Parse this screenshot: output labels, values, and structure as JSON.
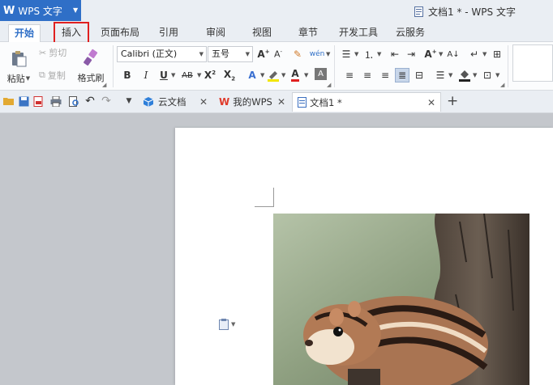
{
  "app": {
    "name": "WPS 文字",
    "logo": "W"
  },
  "window": {
    "title": "文档1 * - WPS 文字"
  },
  "ribbon_tabs": [
    {
      "label": "开始",
      "active": true
    },
    {
      "label": "插入",
      "highlighted": true
    },
    {
      "label": "页面布局"
    },
    {
      "label": "引用"
    },
    {
      "label": "审阅"
    },
    {
      "label": "视图"
    },
    {
      "label": "章节"
    },
    {
      "label": "开发工具"
    },
    {
      "label": "云服务"
    }
  ],
  "clipboard": {
    "paste": "粘贴",
    "cut": "剪切",
    "copy": "复制",
    "format_painter": "格式刷"
  },
  "font": {
    "name": "Calibri (正文)",
    "size": "五号"
  },
  "doc_tabs": [
    {
      "label": "云文档",
      "icon": "cloud-icon"
    },
    {
      "label": "我的WPS",
      "icon": "wps-icon"
    },
    {
      "label": "文档1 *",
      "icon": "doc-icon",
      "active": true
    }
  ],
  "colors": {
    "accent": "#2f6fc7",
    "highlight_box": "#e02020",
    "workspace": "#c4c7cc"
  }
}
